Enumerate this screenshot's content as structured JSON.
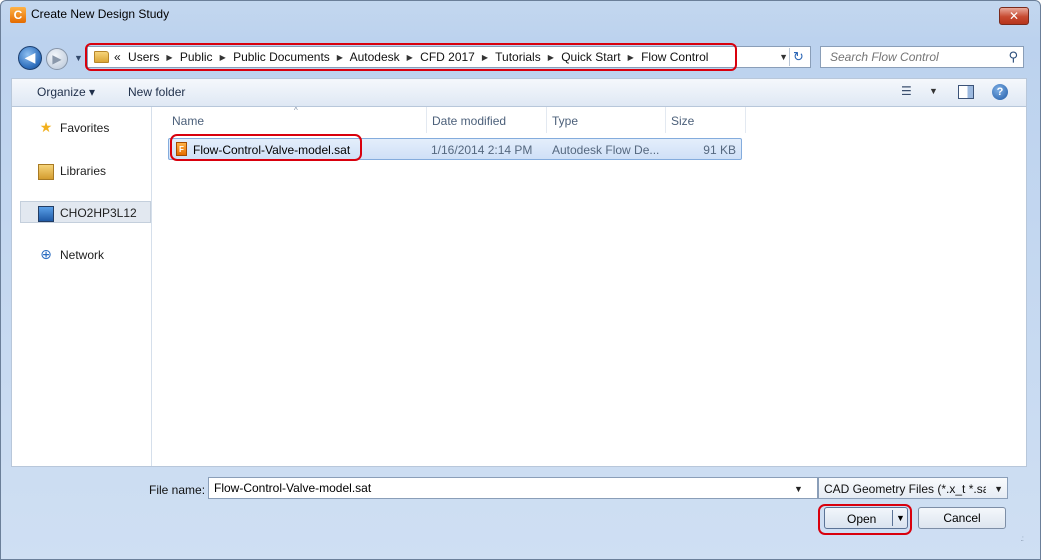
{
  "window": {
    "title": "Create New Design Study",
    "app_icon_glyph": "C",
    "close_glyph": "✕"
  },
  "address": {
    "back_glyph": "◀",
    "forward_glyph": "▶",
    "overflow": "«",
    "path": [
      "Users",
      "Public",
      "Public Documents",
      "Autodesk",
      "CFD 2017",
      "Tutorials",
      "Quick Start",
      "Flow Control"
    ],
    "separator_glyph": "▶",
    "dropdown_glyph": "▼",
    "refresh_glyph": "↻"
  },
  "search": {
    "placeholder": "Search Flow Control",
    "icon_glyph": "⚲"
  },
  "toolbar": {
    "organize_label": "Organize ▾",
    "new_folder_label": "New folder",
    "views_glyph": "☰",
    "views_arrow": "▼",
    "help_glyph": "?"
  },
  "nav": {
    "favorites": "Favorites",
    "libraries": "Libraries",
    "computer": "CHO2HP3L12",
    "network": "Network",
    "star_glyph": "★",
    "network_glyph": "⊕"
  },
  "columns": {
    "name": "Name",
    "date": "Date modified",
    "type": "Type",
    "size": "Size",
    "sort_glyph": "^"
  },
  "files": [
    {
      "name": "Flow-Control-Valve-model.sat",
      "date": "1/16/2014 2:14 PM",
      "type": "Autodesk Flow De...",
      "size": "91 KB",
      "icon_glyph": "F"
    }
  ],
  "footer": {
    "file_name_label": "File name:",
    "file_name_value": "Flow-Control-Valve-model.sat",
    "filter_value": "CAD Geometry Files (*.x_t *.sat",
    "open_label": "Open",
    "cancel_label": "Cancel",
    "dropdown_glyph": "▼",
    "grip_glyph": ".:"
  },
  "colors": {
    "highlight": "#d9000d",
    "selection": "#cfe0f7"
  }
}
